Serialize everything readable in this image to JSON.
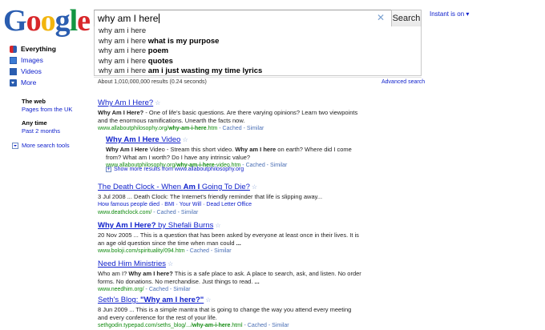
{
  "logo": {
    "text": "Google"
  },
  "search": {
    "query": "why am I here",
    "clear_icon": "close-icon",
    "button_label": "Search",
    "instant_status": "Instant is on ▾"
  },
  "suggestions": [
    {
      "prefix": "why am i here",
      "bold": ""
    },
    {
      "prefix": "why am i here",
      "bold": "what is my purpose"
    },
    {
      "prefix": "why am i here",
      "bold": "poem"
    },
    {
      "prefix": "why am i here",
      "bold": "quotes"
    },
    {
      "prefix": "why am i here",
      "bold": "am i just wasting my time lyrics"
    }
  ],
  "results_info": {
    "count_text": "About 1,010,000,000 results (0.24 seconds)",
    "advanced_search": "Advanced search"
  },
  "left_nav": {
    "items": [
      {
        "label": "Everything",
        "icon": "everything-icon",
        "active": true
      },
      {
        "label": "Images",
        "icon": "images-icon",
        "active": false
      },
      {
        "label": "Videos",
        "icon": "videos-icon",
        "active": false
      },
      {
        "label": "More",
        "icon": "more-icon",
        "active": false
      }
    ],
    "web_heading": "The web",
    "web_link": "Pages from the UK",
    "time_heading": "Any time",
    "time_link": "Past 2 months",
    "more_tools": "More search tools"
  },
  "results": [
    {
      "title": "Why Am I Here?",
      "snippet_bold": "Why Am I Here?",
      "snippet": " - One of life's basic questions. Are there varying opinions? Learn two viewpoints and the enormous ramifications. Unearth the facts now.",
      "url_plain": "www.allaboutphilosophy.org/",
      "url_bold": "why-am-i-here",
      "url_tail": ".htm",
      "cached": "Cached",
      "similar": "Similar"
    },
    {
      "title_bold_1": "Why Am I Here",
      "title_tail": " Video",
      "snippet_bold_1": "Why Am I Here",
      "snippet_mid_1": " Video - Stream this short video. ",
      "snippet_bold_2": "Why am I here",
      "snippet_tail": " on earth? Where did I come from? What am I worth? Do I have any intrinsic value?",
      "url_plain": "www.allaboutphilosophy.org/",
      "url_bold": "why-am-i-here",
      "url_tail": "-video.htm",
      "cached": "Cached",
      "similar": "Similar",
      "show_more": "Show more results from www.allaboutphilosophy.org"
    },
    {
      "title_pre": "The Death Clock - When ",
      "title_bold_1": "Am I",
      "title_tail": " Going To Die?",
      "date": "3 Jul 2008",
      "snippet": " ... Death Clock: The Internet's friendly reminder that life is slipping away...",
      "sitelinks": "How famous people died · BMI · Your Will · Dead Letter Office",
      "url_plain": "www.deathclock.com/",
      "cached": "Cached",
      "similar": "Similar"
    },
    {
      "title_bold_1": "Why Am I Here?",
      "title_tail": " by Shefali Burns",
      "date": "20 Nov 2005",
      "snippet": " ... This is a question that has been asked by everyone at least once in their lives. It is an age old question since the time when man could ",
      "snippet_end": "...",
      "url_plain": "www.boloji.com/spirituality/094.htm",
      "cached": "Cached",
      "similar": "Similar"
    },
    {
      "title": "Need Him Ministries",
      "snippet_pre": "Who am I? ",
      "snippet_bold_1": "Why am I here?",
      "snippet_tail": " This is a safe place to ask. A place to search, ask, and listen. No order forms. No donations. No merchandise. Just things to read. ",
      "snippet_end": "...",
      "url_plain": "www.needhim.org/",
      "cached": "Cached",
      "similar": "Similar"
    },
    {
      "title_pre": "Seth's Blog: ",
      "title_bold_1": "\"Why am I here?\"",
      "date": "8 Jun 2009",
      "snippet": " ... This is a simple mantra that is going to change the way you attend every meeting and every conference for the rest of your life.",
      "url_plain": "sethgodin.typepad.com/seths_blog/.../",
      "url_bold": "why-am-i-here",
      "url_tail": ".html",
      "cached": "Cached",
      "similar": "Similar"
    }
  ]
}
